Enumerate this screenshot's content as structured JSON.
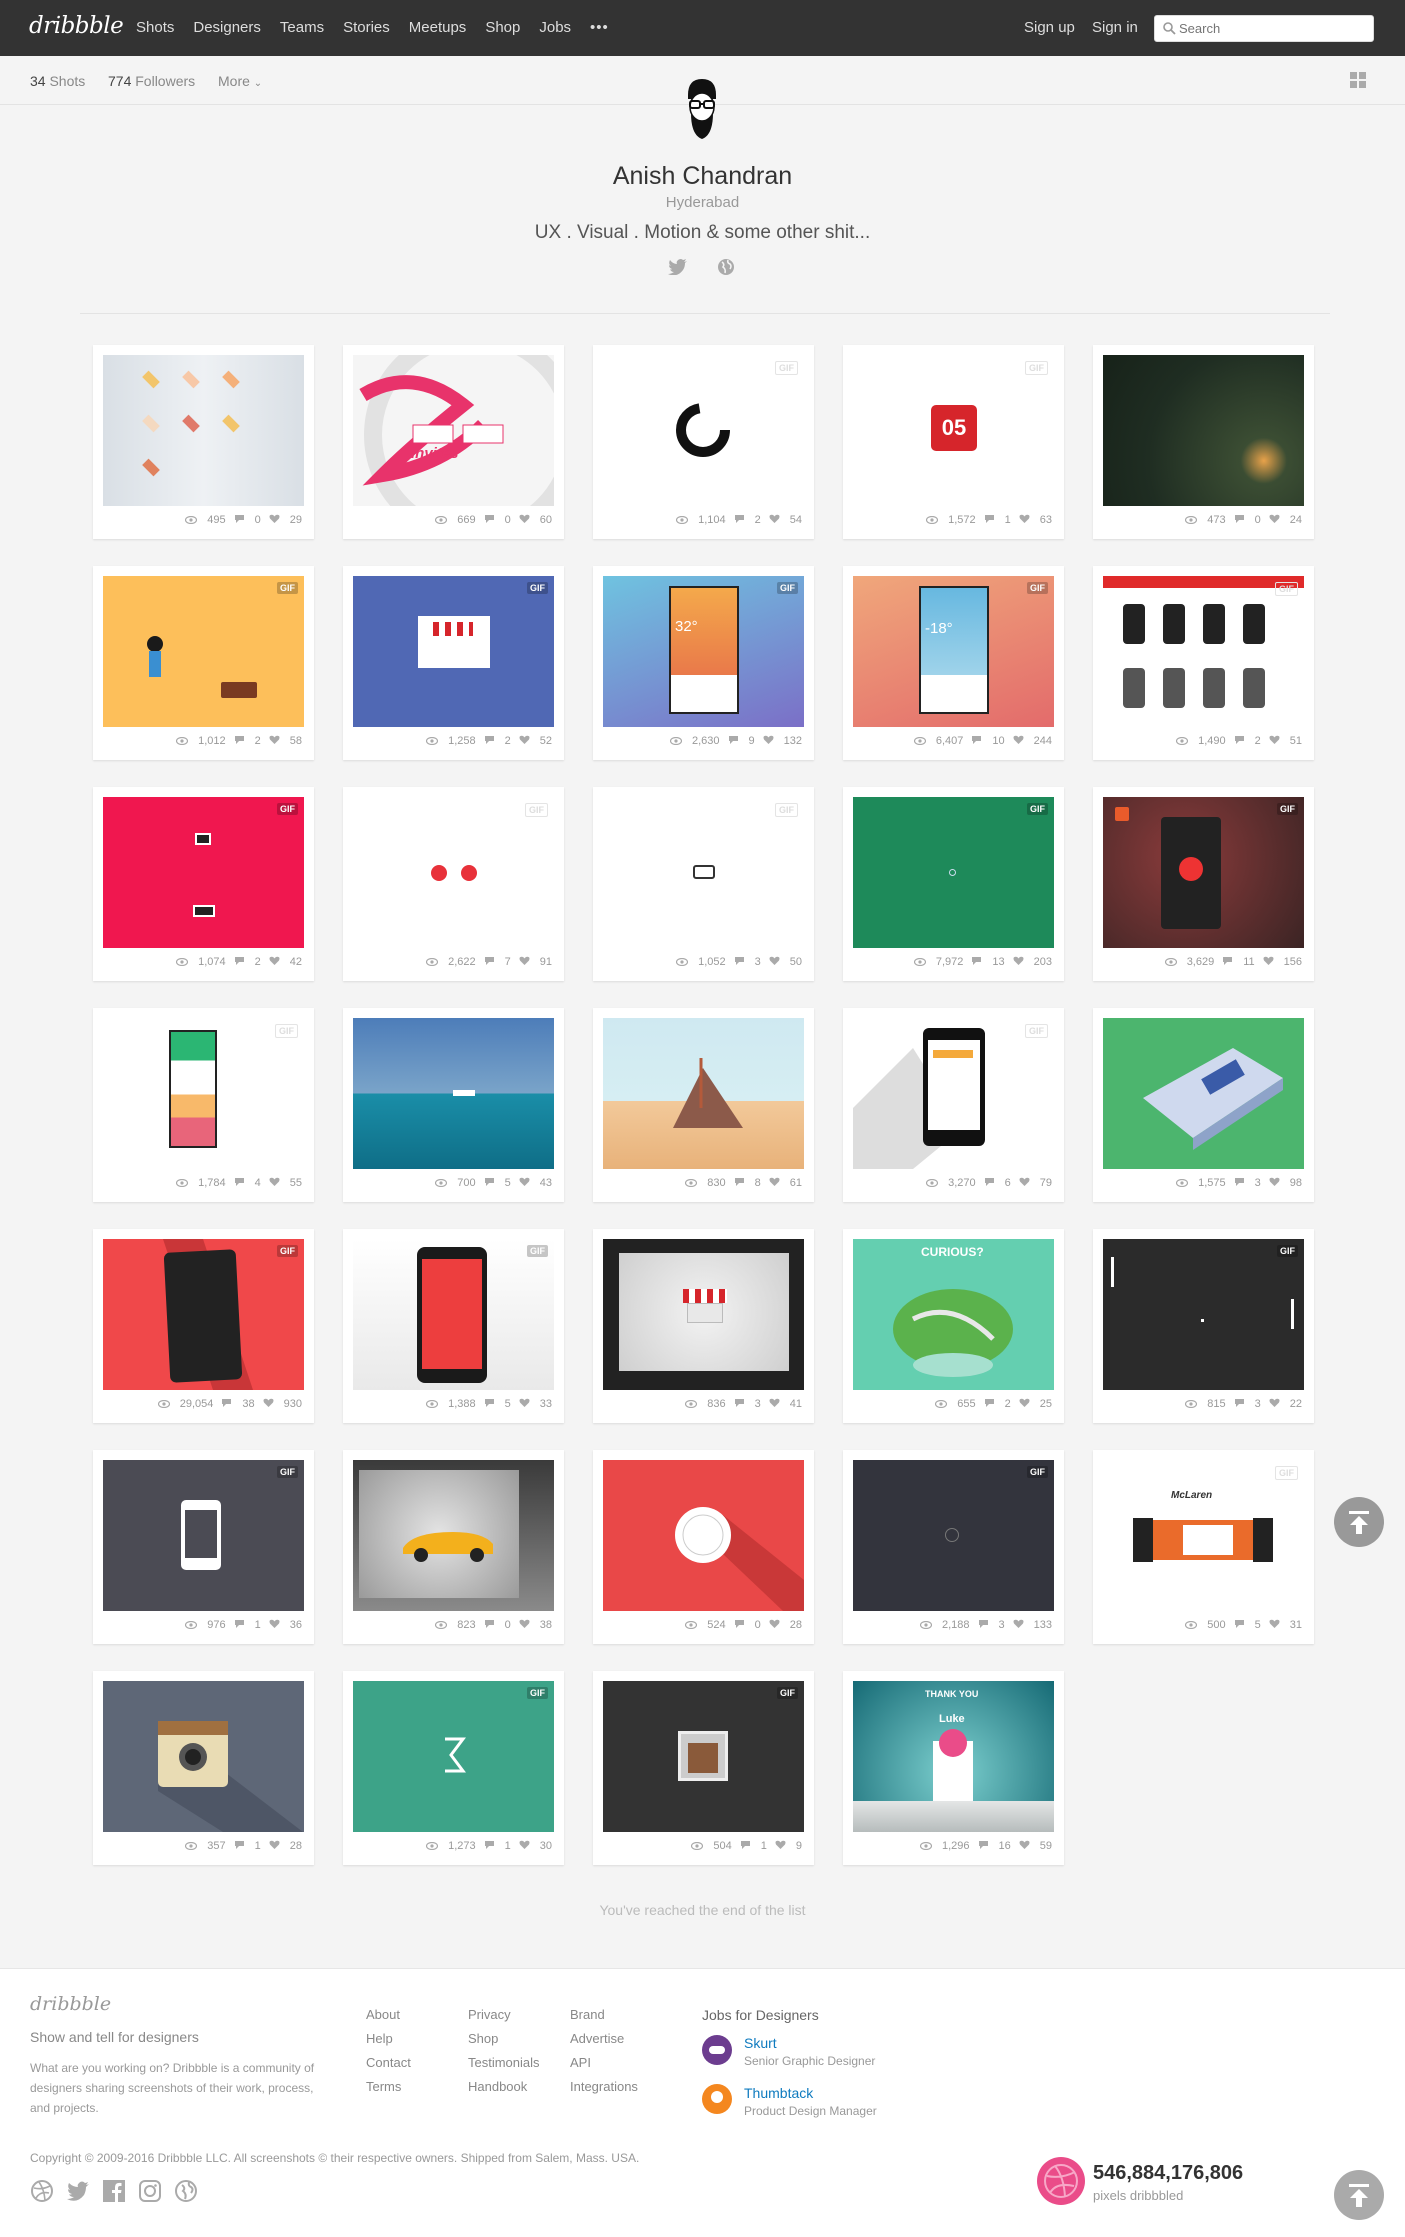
{
  "topnav": {
    "logo": "dribbble",
    "links": [
      "Shots",
      "Designers",
      "Teams",
      "Stories",
      "Meetups",
      "Shop",
      "Jobs",
      "•••"
    ],
    "signup": "Sign up",
    "signin": "Sign in",
    "search_placeholder": "Search"
  },
  "subnav": {
    "shots_count": "34",
    "shots_label": " Shots",
    "followers_count": "774",
    "followers_label": " Followers",
    "more": "More"
  },
  "profile": {
    "name": "Anish Chandran",
    "location": "Hyderabad",
    "bio": "UX . Visual . Motion & some other shit..."
  },
  "gif_label": "GIF",
  "shots": [
    {
      "views": "495",
      "comments": "0",
      "likes": "29",
      "gif": false
    },
    {
      "views": "669",
      "comments": "0",
      "likes": "60",
      "gif": false,
      "thumb_text": "invites"
    },
    {
      "views": "1,104",
      "comments": "2",
      "likes": "54",
      "gif": true
    },
    {
      "views": "1,572",
      "comments": "1",
      "likes": "63",
      "gif": true,
      "thumb_text": "05"
    },
    {
      "views": "473",
      "comments": "0",
      "likes": "24",
      "gif": false
    },
    {
      "views": "1,012",
      "comments": "2",
      "likes": "58",
      "gif": true
    },
    {
      "views": "1,258",
      "comments": "2",
      "likes": "52",
      "gif": true
    },
    {
      "views": "2,630",
      "comments": "9",
      "likes": "132",
      "gif": true,
      "thumb_text": "32°"
    },
    {
      "views": "6,407",
      "comments": "10",
      "likes": "244",
      "gif": true,
      "thumb_text": "-18°"
    },
    {
      "views": "1,490",
      "comments": "2",
      "likes": "51",
      "gif": true
    },
    {
      "views": "1,074",
      "comments": "2",
      "likes": "42",
      "gif": true
    },
    {
      "views": "2,622",
      "comments": "7",
      "likes": "91",
      "gif": true
    },
    {
      "views": "1,052",
      "comments": "3",
      "likes": "50",
      "gif": true
    },
    {
      "views": "7,972",
      "comments": "13",
      "likes": "203",
      "gif": true
    },
    {
      "views": "3,629",
      "comments": "11",
      "likes": "156",
      "gif": true
    },
    {
      "views": "1,784",
      "comments": "4",
      "likes": "55",
      "gif": true
    },
    {
      "views": "700",
      "comments": "5",
      "likes": "43",
      "gif": false
    },
    {
      "views": "830",
      "comments": "8",
      "likes": "61",
      "gif": false
    },
    {
      "views": "3,270",
      "comments": "6",
      "likes": "79",
      "gif": true
    },
    {
      "views": "1,575",
      "comments": "3",
      "likes": "98",
      "gif": false
    },
    {
      "views": "29,054",
      "comments": "38",
      "likes": "930",
      "gif": true
    },
    {
      "views": "1,388",
      "comments": "5",
      "likes": "33",
      "gif": true
    },
    {
      "views": "836",
      "comments": "3",
      "likes": "41",
      "gif": false
    },
    {
      "views": "655",
      "comments": "2",
      "likes": "25",
      "gif": false,
      "thumb_text": "CURIOUS?"
    },
    {
      "views": "815",
      "comments": "3",
      "likes": "22",
      "gif": true
    },
    {
      "views": "976",
      "comments": "1",
      "likes": "36",
      "gif": true
    },
    {
      "views": "823",
      "comments": "0",
      "likes": "38",
      "gif": false
    },
    {
      "views": "524",
      "comments": "0",
      "likes": "28",
      "gif": false
    },
    {
      "views": "2,188",
      "comments": "3",
      "likes": "133",
      "gif": true
    },
    {
      "views": "500",
      "comments": "5",
      "likes": "31",
      "gif": true,
      "thumb_text": "McLaren"
    },
    {
      "views": "357",
      "comments": "1",
      "likes": "28",
      "gif": false
    },
    {
      "views": "1,273",
      "comments": "1",
      "likes": "30",
      "gif": true
    },
    {
      "views": "504",
      "comments": "1",
      "likes": "9",
      "gif": true
    },
    {
      "views": "1,296",
      "comments": "16",
      "likes": "59",
      "gif": false,
      "thumb_text": "THANK YOU",
      "thumb_text2": "Luke"
    }
  ],
  "end_message": "You've reached the end of the list",
  "footer": {
    "logo": "dribbble",
    "tagline": "Show and tell for designers",
    "about": "What are you working on? Dribbble is a community of designers sharing screenshots of their work, process, and projects.",
    "col1": [
      "About",
      "Help",
      "Contact",
      "Terms"
    ],
    "col2": [
      "Privacy",
      "Shop",
      "Testimonials",
      "Handbook"
    ],
    "col3": [
      "Brand",
      "Advertise",
      "API",
      "Integrations"
    ],
    "jobs_title": "Jobs for Designers",
    "jobs": [
      {
        "company": "Skurt",
        "role": "Senior Graphic Designer"
      },
      {
        "company": "Thumbtack",
        "role": "Product Design Manager"
      }
    ],
    "copyright": "Copyright © 2009-2016 Dribbble LLC. All screenshots © their respective owners. Shipped from Salem, Mass. USA.",
    "pixels_count": "546,884,176,806",
    "pixels_label": "pixels dribbbled"
  },
  "colors": {
    "topnav_bg": "#333333",
    "dribbble_pink": "#ea4c89",
    "accent_blue": "#0f7bbf"
  }
}
